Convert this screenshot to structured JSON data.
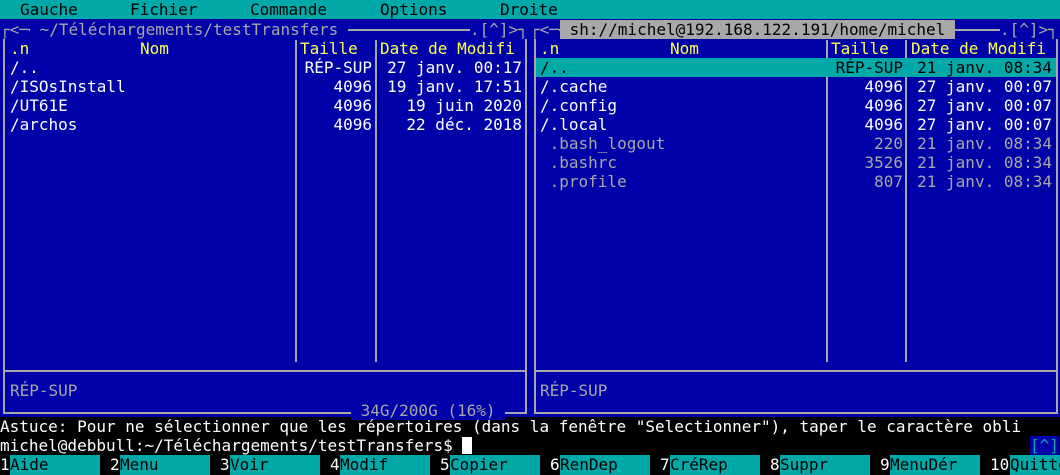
{
  "menu": [
    "Gauche",
    "Fichier",
    "Commande",
    "Options",
    "Droite"
  ],
  "left_panel": {
    "path": " ~/Téléchargements/testTransfers ",
    "corner_left": "┌<─",
    "corner_right": ".[^]>┐",
    "headers": {
      "n": ".n",
      "name": "Nom",
      "size": "Taille",
      "date": "Date de Modifi"
    },
    "rows": [
      {
        "name": "/..",
        "size": "RÉP-SUP",
        "date": "27 janv. 00:17"
      },
      {
        "name": "/ISOsInstall",
        "size": "4096",
        "date": "19 janv. 17:51"
      },
      {
        "name": "/UT61E",
        "size": "4096",
        "date": "19 juin 2020"
      },
      {
        "name": "/archos",
        "size": "4096",
        "date": "22 déc. 2018"
      }
    ],
    "status": "RÉP-SUP",
    "disk": " 34G/200G (16%) "
  },
  "right_panel": {
    "path": " sh://michel@192.168.122.191/home/michel ",
    "corner_left": "┌<─",
    "corner_right": ".[^]>┐",
    "headers": {
      "n": ".n",
      "name": "Nom",
      "size": "Taille",
      "date": "Date de Modifi"
    },
    "rows": [
      {
        "name": "/..",
        "size": "RÉP-SUP",
        "date": "21 janv. 08:34",
        "selected": true
      },
      {
        "name": "/.cache",
        "size": "4096",
        "date": "27 janv. 00:07"
      },
      {
        "name": "/.config",
        "size": "4096",
        "date": "27 janv. 00:07"
      },
      {
        "name": "/.local",
        "size": "4096",
        "date": "27 janv. 00:07"
      },
      {
        "name": " .bash_logout",
        "size": "220",
        "date": "21 janv. 08:34"
      },
      {
        "name": " .bashrc",
        "size": "3526",
        "date": "21 janv. 08:34"
      },
      {
        "name": " .profile",
        "size": "807",
        "date": "21 janv. 08:34"
      }
    ],
    "status": "RÉP-SUP"
  },
  "hint": "Astuce: Pour ne sélectionner que les répertoires (dans la fenêtre \"Selectionner\"), taper le caractère obli",
  "prompt": "michel@debbull:~/Téléchargements/testTransfers$ ",
  "corner_indicator": "[^]",
  "fkeys": [
    {
      "num": "1",
      "label": "Aide"
    },
    {
      "num": "2",
      "label": "Menu"
    },
    {
      "num": "3",
      "label": "Voir"
    },
    {
      "num": "4",
      "label": "Modif"
    },
    {
      "num": "5",
      "label": "Copier"
    },
    {
      "num": "6",
      "label": "RenDep"
    },
    {
      "num": "7",
      "label": "CréRep"
    },
    {
      "num": "8",
      "label": "Suppr"
    },
    {
      "num": "9",
      "label": "MenuDér"
    },
    {
      "num": "10",
      "label": "Quitter"
    }
  ]
}
